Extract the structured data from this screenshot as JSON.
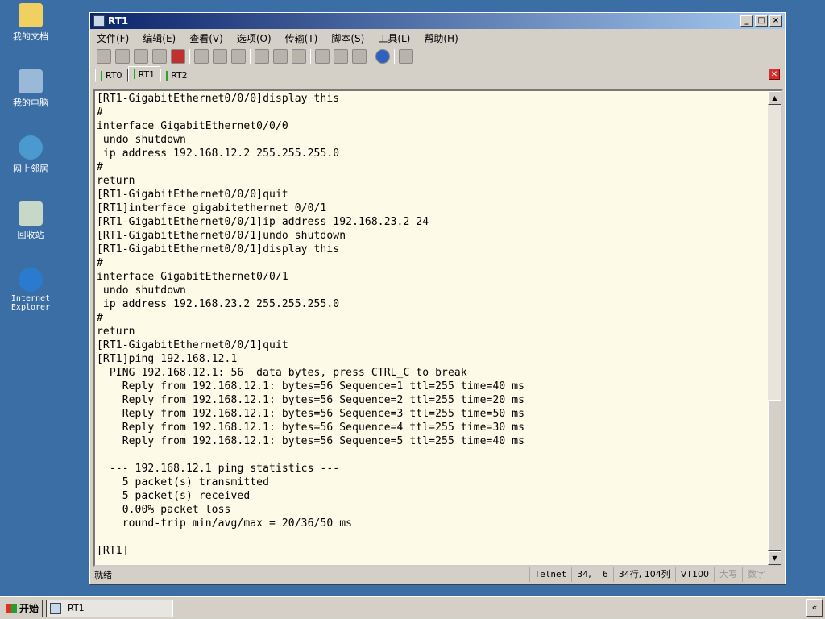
{
  "desktop": [
    "我的文档",
    "我的电脑",
    "网上邻居",
    "回收站",
    "Internet Explorer"
  ],
  "window": {
    "title": "RT1",
    "min": "_",
    "max": "□",
    "close": "×"
  },
  "menu": [
    "文件(F)",
    "编辑(E)",
    "查看(V)",
    "选项(O)",
    "传输(T)",
    "脚本(S)",
    "工具(L)",
    "帮助(H)"
  ],
  "tabs": [
    "RT0",
    "RT1",
    "RT2"
  ],
  "terminal": "[RT1-GigabitEthernet0/0/0]display this\n#\ninterface GigabitEthernet0/0/0\n undo shutdown\n ip address 192.168.12.2 255.255.255.0\n#\nreturn\n[RT1-GigabitEthernet0/0/0]quit\n[RT1]interface gigabitethernet 0/0/1\n[RT1-GigabitEthernet0/0/1]ip address 192.168.23.2 24\n[RT1-GigabitEthernet0/0/1]undo shutdown\n[RT1-GigabitEthernet0/0/1]display this\n#\ninterface GigabitEthernet0/0/1\n undo shutdown\n ip address 192.168.23.2 255.255.255.0\n#\nreturn\n[RT1-GigabitEthernet0/0/1]quit\n[RT1]ping 192.168.12.1\n  PING 192.168.12.1: 56  data bytes, press CTRL_C to break\n    Reply from 192.168.12.1: bytes=56 Sequence=1 ttl=255 time=40 ms\n    Reply from 192.168.12.1: bytes=56 Sequence=2 ttl=255 time=20 ms\n    Reply from 192.168.12.1: bytes=56 Sequence=3 ttl=255 time=50 ms\n    Reply from 192.168.12.1: bytes=56 Sequence=4 ttl=255 time=30 ms\n    Reply from 192.168.12.1: bytes=56 Sequence=5 ttl=255 time=40 ms\n\n  --- 192.168.12.1 ping statistics ---\n    5 packet(s) transmitted\n    5 packet(s) received\n    0.00% packet loss\n    round-trip min/avg/max = 20/36/50 ms\n\n[RT1]",
  "status": {
    "ready": "就绪",
    "protocol": "Telnet",
    "cursor": "34,    6",
    "size": "34行, 104列",
    "emulation": "VT100",
    "caps": "大写",
    "num": "数字"
  },
  "taskbar": {
    "start": "开始",
    "task": "RT1",
    "tray": "«"
  }
}
